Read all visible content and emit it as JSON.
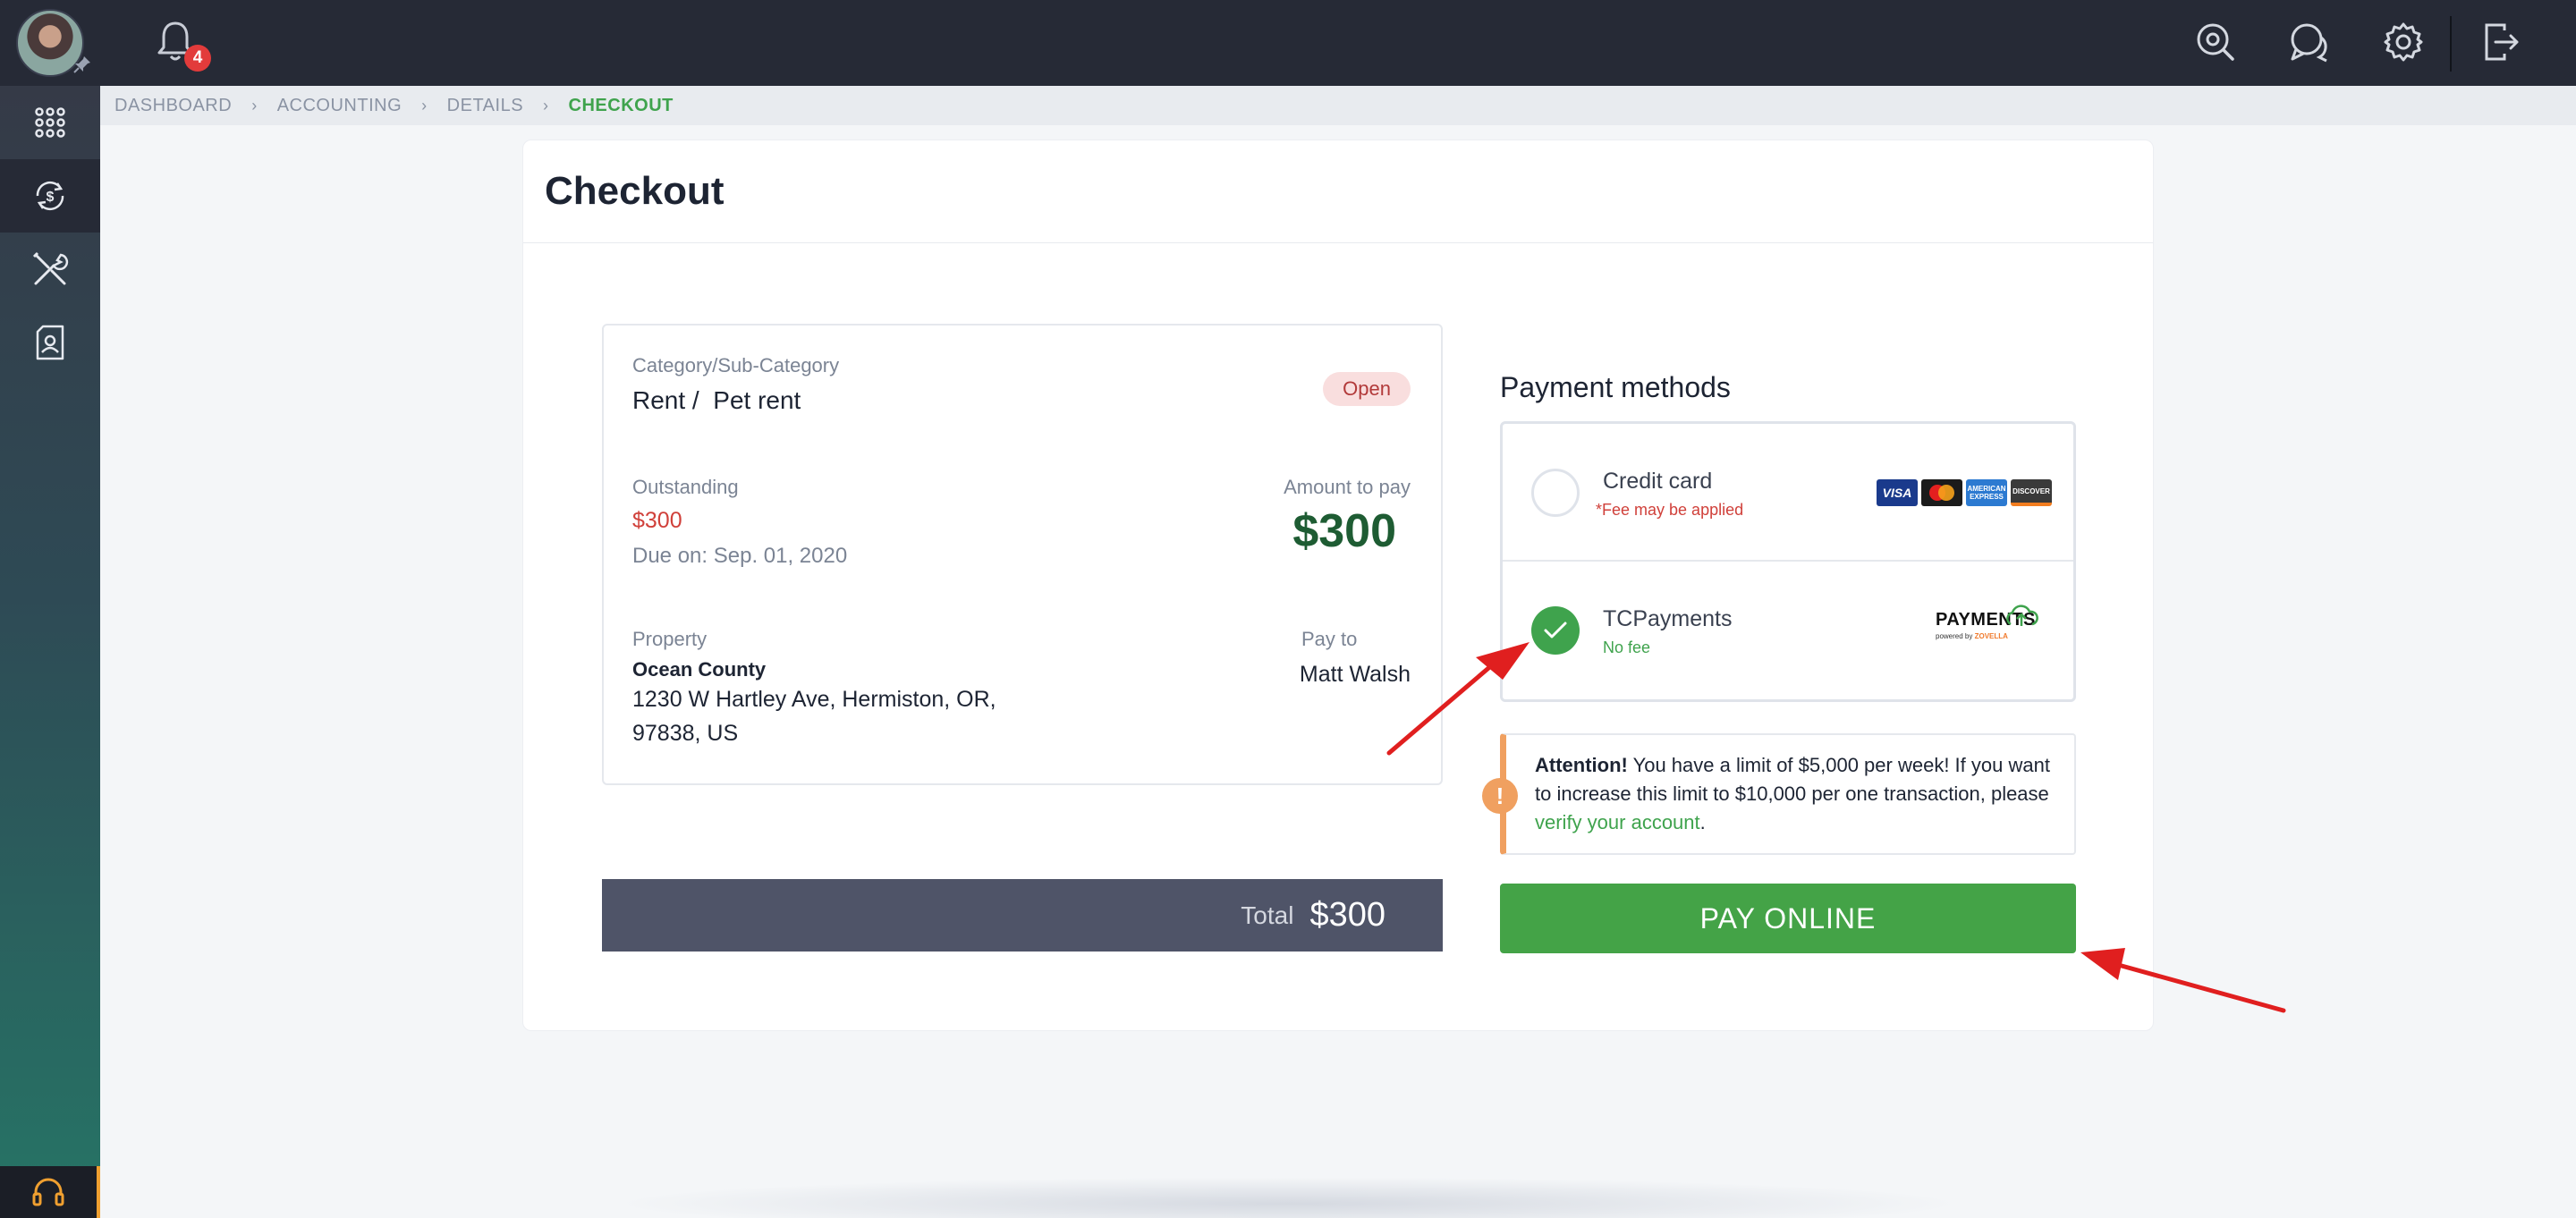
{
  "topbar": {
    "notification_count": "4",
    "icons": [
      "search-icon",
      "chat-icon",
      "gear-icon",
      "logout-icon"
    ]
  },
  "sidebar": {
    "items": [
      {
        "icon": "apps-grid-icon"
      },
      {
        "icon": "accounting-icon",
        "active": true
      },
      {
        "icon": "tools-icon"
      },
      {
        "icon": "contact-card-icon"
      }
    ],
    "bottom_icon": "headset-icon"
  },
  "breadcrumb": {
    "items": [
      "DASHBOARD",
      "ACCOUNTING",
      "DETAILS"
    ],
    "current": "CHECKOUT"
  },
  "page": {
    "title": "Checkout"
  },
  "details": {
    "category_label": "Category/Sub-Category",
    "category_value": "Rent /  Pet rent",
    "status": "Open",
    "outstanding_label": "Outstanding",
    "outstanding_value": "$300",
    "due_label": "Due on:",
    "due_value": "Sep. 01, 2020",
    "amount_label": "Amount to pay",
    "amount_value": "$300",
    "property_label": "Property",
    "property_name": "Ocean County",
    "property_address_1": "1230 W Hartley Ave, Hermiston, OR,",
    "property_address_2": "97838, US",
    "payto_label": "Pay to",
    "payto_value": "Matt Walsh"
  },
  "total": {
    "label": "Total",
    "value": "$300"
  },
  "payment": {
    "title": "Payment methods",
    "methods": [
      {
        "name": "Credit card",
        "note_star": "*",
        "note": "Fee may be applied",
        "selected": false,
        "logos": [
          "VISA",
          "MC",
          "AMEX",
          "DISCOVER"
        ]
      },
      {
        "name": "TCPayments",
        "note": "No fee",
        "selected": true,
        "logo_text": "PAYMENTS",
        "logo_sub": "powered by",
        "logo_brand": "ZOVELLA"
      }
    ]
  },
  "attention": {
    "bold": "Attention!",
    "text": " You have a limit of $5,000 per week! If you want to increase this limit to $10,000 per one transaction, please ",
    "link": "verify your account",
    "end": "."
  },
  "pay_button": {
    "label": "PAY ONLINE"
  },
  "colors": {
    "accent_green": "#44a347",
    "outstanding_red": "#d0403a",
    "topbar_bg": "#262a36",
    "total_bar": "#4f5468",
    "attention_orange": "#f0a060",
    "annotation_arrow": "#e01f1f"
  }
}
